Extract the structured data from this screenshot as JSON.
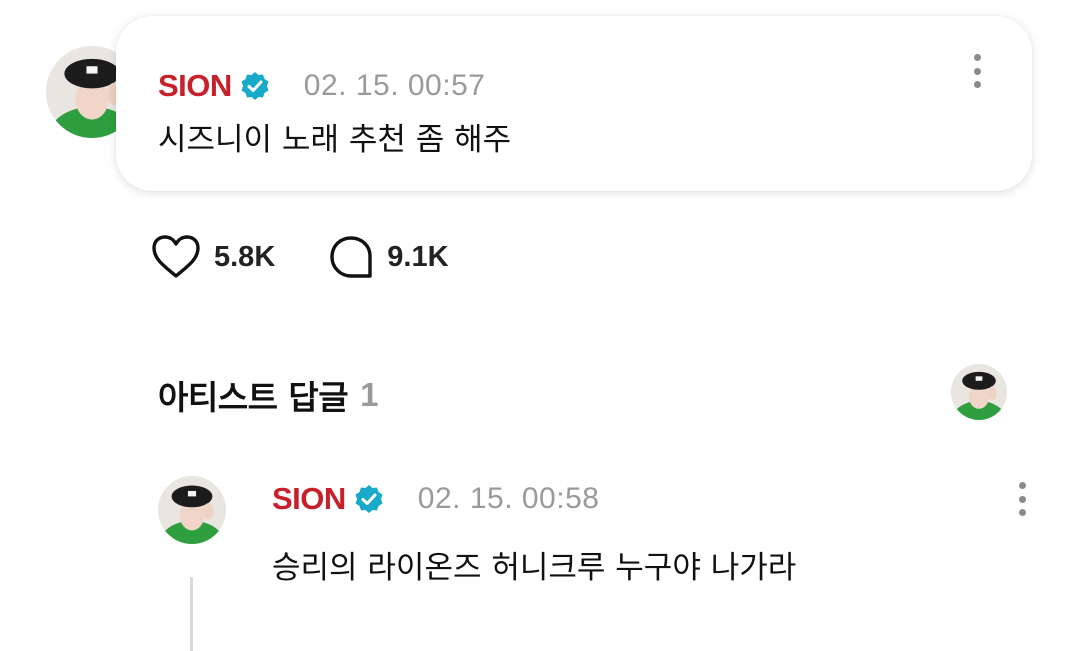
{
  "post": {
    "author": "SION",
    "timestamp": "02. 15. 00:57",
    "text": "시즈니이 노래 추천 좀 해주",
    "likes": "5.8K",
    "comments": "9.1K"
  },
  "replies_section": {
    "title": "아티스트 답글",
    "count": "1"
  },
  "reply": {
    "author": "SION",
    "timestamp": "02. 15. 00:58",
    "text": "승리의 라이온즈 허니크루 누구야 나가라"
  },
  "colors": {
    "author_name": "#c8202a",
    "verified_badge": "#19a9c9",
    "timestamp": "#9a9a9a",
    "count_gray": "#9a9a9a"
  },
  "icons": {
    "verified": "verified-badge-icon",
    "more": "more-vertical-icon",
    "like": "heart-icon",
    "comment": "comment-bubble-icon"
  }
}
